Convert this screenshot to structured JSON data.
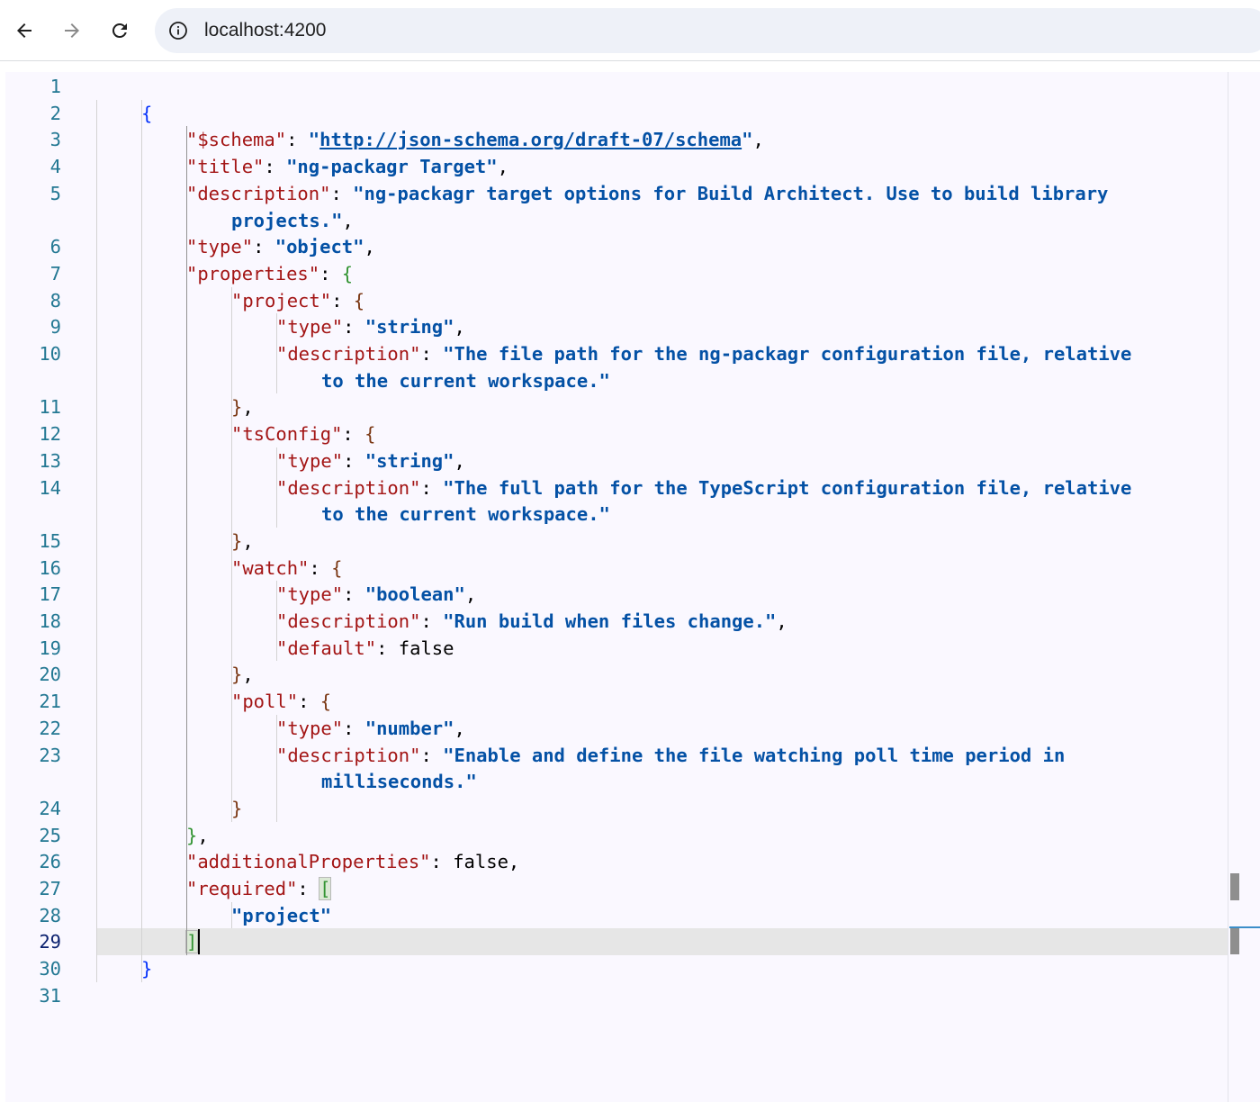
{
  "browser": {
    "url": "localhost:4200",
    "back_icon": "arrow-left-icon",
    "forward_icon": "arrow-right-icon",
    "reload_icon": "reload-icon",
    "site_info_icon": "info-icon"
  },
  "editor": {
    "active_line": 29,
    "lines": [
      {
        "n": "1",
        "t": []
      },
      {
        "n": "2",
        "t": [
          [
            "b0",
            "{"
          ]
        ]
      },
      {
        "n": "3",
        "t": [
          [
            "k",
            "\"$schema\""
          ],
          [
            "p",
            ": "
          ],
          [
            "s",
            "\""
          ],
          [
            "s-link",
            "http://json-schema.org/draft-07/schema"
          ],
          [
            "s",
            "\""
          ],
          [
            "p",
            ","
          ]
        ]
      },
      {
        "n": "4",
        "t": [
          [
            "k",
            "\"title\""
          ],
          [
            "p",
            ": "
          ],
          [
            "s",
            "\"ng-packagr Target\""
          ],
          [
            "p",
            ","
          ]
        ]
      },
      {
        "n": "5",
        "t": [
          [
            "k",
            "\"description\""
          ],
          [
            "p",
            ": "
          ],
          [
            "s",
            "\"ng-packagr target options for Build Architect. Use to build library"
          ]
        ]
      },
      {
        "n": "",
        "t": [
          [
            "s",
            "projects.\""
          ],
          [
            "p",
            ","
          ]
        ]
      },
      {
        "n": "6",
        "t": [
          [
            "k",
            "\"type\""
          ],
          [
            "p",
            ": "
          ],
          [
            "s",
            "\"object\""
          ],
          [
            "p",
            ","
          ]
        ]
      },
      {
        "n": "7",
        "t": [
          [
            "k",
            "\"properties\""
          ],
          [
            "p",
            ": "
          ],
          [
            "b1",
            "{"
          ]
        ]
      },
      {
        "n": "8",
        "t": [
          [
            "k",
            "\"project\""
          ],
          [
            "p",
            ": "
          ],
          [
            "b2",
            "{"
          ]
        ]
      },
      {
        "n": "9",
        "t": [
          [
            "k",
            "\"type\""
          ],
          [
            "p",
            ": "
          ],
          [
            "s",
            "\"string\""
          ],
          [
            "p",
            ","
          ]
        ]
      },
      {
        "n": "10",
        "t": [
          [
            "k",
            "\"description\""
          ],
          [
            "p",
            ": "
          ],
          [
            "s",
            "\"The file path for the ng-packagr configuration file, relative"
          ]
        ]
      },
      {
        "n": "",
        "t": [
          [
            "s",
            "to the current workspace.\""
          ]
        ]
      },
      {
        "n": "11",
        "t": [
          [
            "b2",
            "}"
          ],
          [
            "p",
            ","
          ]
        ]
      },
      {
        "n": "12",
        "t": [
          [
            "k",
            "\"tsConfig\""
          ],
          [
            "p",
            ": "
          ],
          [
            "b2",
            "{"
          ]
        ]
      },
      {
        "n": "13",
        "t": [
          [
            "k",
            "\"type\""
          ],
          [
            "p",
            ": "
          ],
          [
            "s",
            "\"string\""
          ],
          [
            "p",
            ","
          ]
        ]
      },
      {
        "n": "14",
        "t": [
          [
            "k",
            "\"description\""
          ],
          [
            "p",
            ": "
          ],
          [
            "s",
            "\"The full path for the TypeScript configuration file, relative"
          ]
        ]
      },
      {
        "n": "",
        "t": [
          [
            "s",
            "to the current workspace.\""
          ]
        ]
      },
      {
        "n": "15",
        "t": [
          [
            "b2",
            "}"
          ],
          [
            "p",
            ","
          ]
        ]
      },
      {
        "n": "16",
        "t": [
          [
            "k",
            "\"watch\""
          ],
          [
            "p",
            ": "
          ],
          [
            "b2",
            "{"
          ]
        ]
      },
      {
        "n": "17",
        "t": [
          [
            "k",
            "\"type\""
          ],
          [
            "p",
            ": "
          ],
          [
            "s",
            "\"boolean\""
          ],
          [
            "p",
            ","
          ]
        ]
      },
      {
        "n": "18",
        "t": [
          [
            "k",
            "\"description\""
          ],
          [
            "p",
            ": "
          ],
          [
            "s",
            "\"Run build when files change.\""
          ],
          [
            "p",
            ","
          ]
        ]
      },
      {
        "n": "19",
        "t": [
          [
            "k",
            "\"default\""
          ],
          [
            "p",
            ": false"
          ]
        ]
      },
      {
        "n": "20",
        "t": [
          [
            "b2",
            "}"
          ],
          [
            "p",
            ","
          ]
        ]
      },
      {
        "n": "21",
        "t": [
          [
            "k",
            "\"poll\""
          ],
          [
            "p",
            ": "
          ],
          [
            "b2",
            "{"
          ]
        ]
      },
      {
        "n": "22",
        "t": [
          [
            "k",
            "\"type\""
          ],
          [
            "p",
            ": "
          ],
          [
            "s",
            "\"number\""
          ],
          [
            "p",
            ","
          ]
        ]
      },
      {
        "n": "23",
        "t": [
          [
            "k",
            "\"description\""
          ],
          [
            "p",
            ": "
          ],
          [
            "s",
            "\"Enable and define the file watching poll time period in"
          ]
        ]
      },
      {
        "n": "",
        "t": [
          [
            "s",
            "milliseconds.\""
          ]
        ]
      },
      {
        "n": "24",
        "t": [
          [
            "b2",
            "}"
          ]
        ]
      },
      {
        "n": "25",
        "t": [
          [
            "b1",
            "}"
          ],
          [
            "p",
            ","
          ]
        ]
      },
      {
        "n": "26",
        "t": [
          [
            "k",
            "\"additionalProperties\""
          ],
          [
            "p",
            ": false,"
          ]
        ]
      },
      {
        "n": "27",
        "t": [
          [
            "k",
            "\"required\""
          ],
          [
            "p",
            ": "
          ],
          [
            "b1m",
            "["
          ]
        ]
      },
      {
        "n": "28",
        "t": [
          [
            "s",
            "\"project\""
          ]
        ]
      },
      {
        "n": "29",
        "t": [
          [
            "b1m",
            "]"
          ]
        ]
      },
      {
        "n": "30",
        "t": [
          [
            "b0",
            "}"
          ]
        ]
      },
      {
        "n": "31",
        "t": []
      }
    ]
  }
}
